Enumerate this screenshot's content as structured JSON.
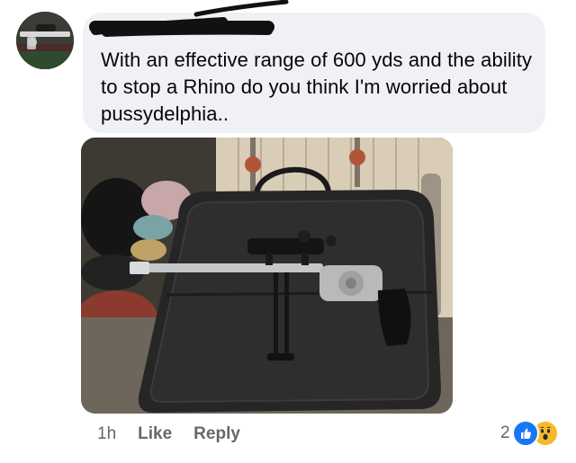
{
  "comment": {
    "text": "With an effective range of 600 yds and the ability to stop a Rhino do you think I'm worried about pussydelphia..",
    "author_name": ""
  },
  "actions": {
    "timestamp": "1h",
    "like_label": "Like",
    "reply_label": "Reply"
  },
  "reactions": {
    "count": "2",
    "icons": [
      "like-icon",
      "wow-icon"
    ]
  },
  "colors": {
    "bubble_bg": "#eff1f4",
    "text": "#050505",
    "meta_text": "#65676b",
    "like_blue": "#1877f2",
    "wow_yellow": "#f7b928"
  }
}
